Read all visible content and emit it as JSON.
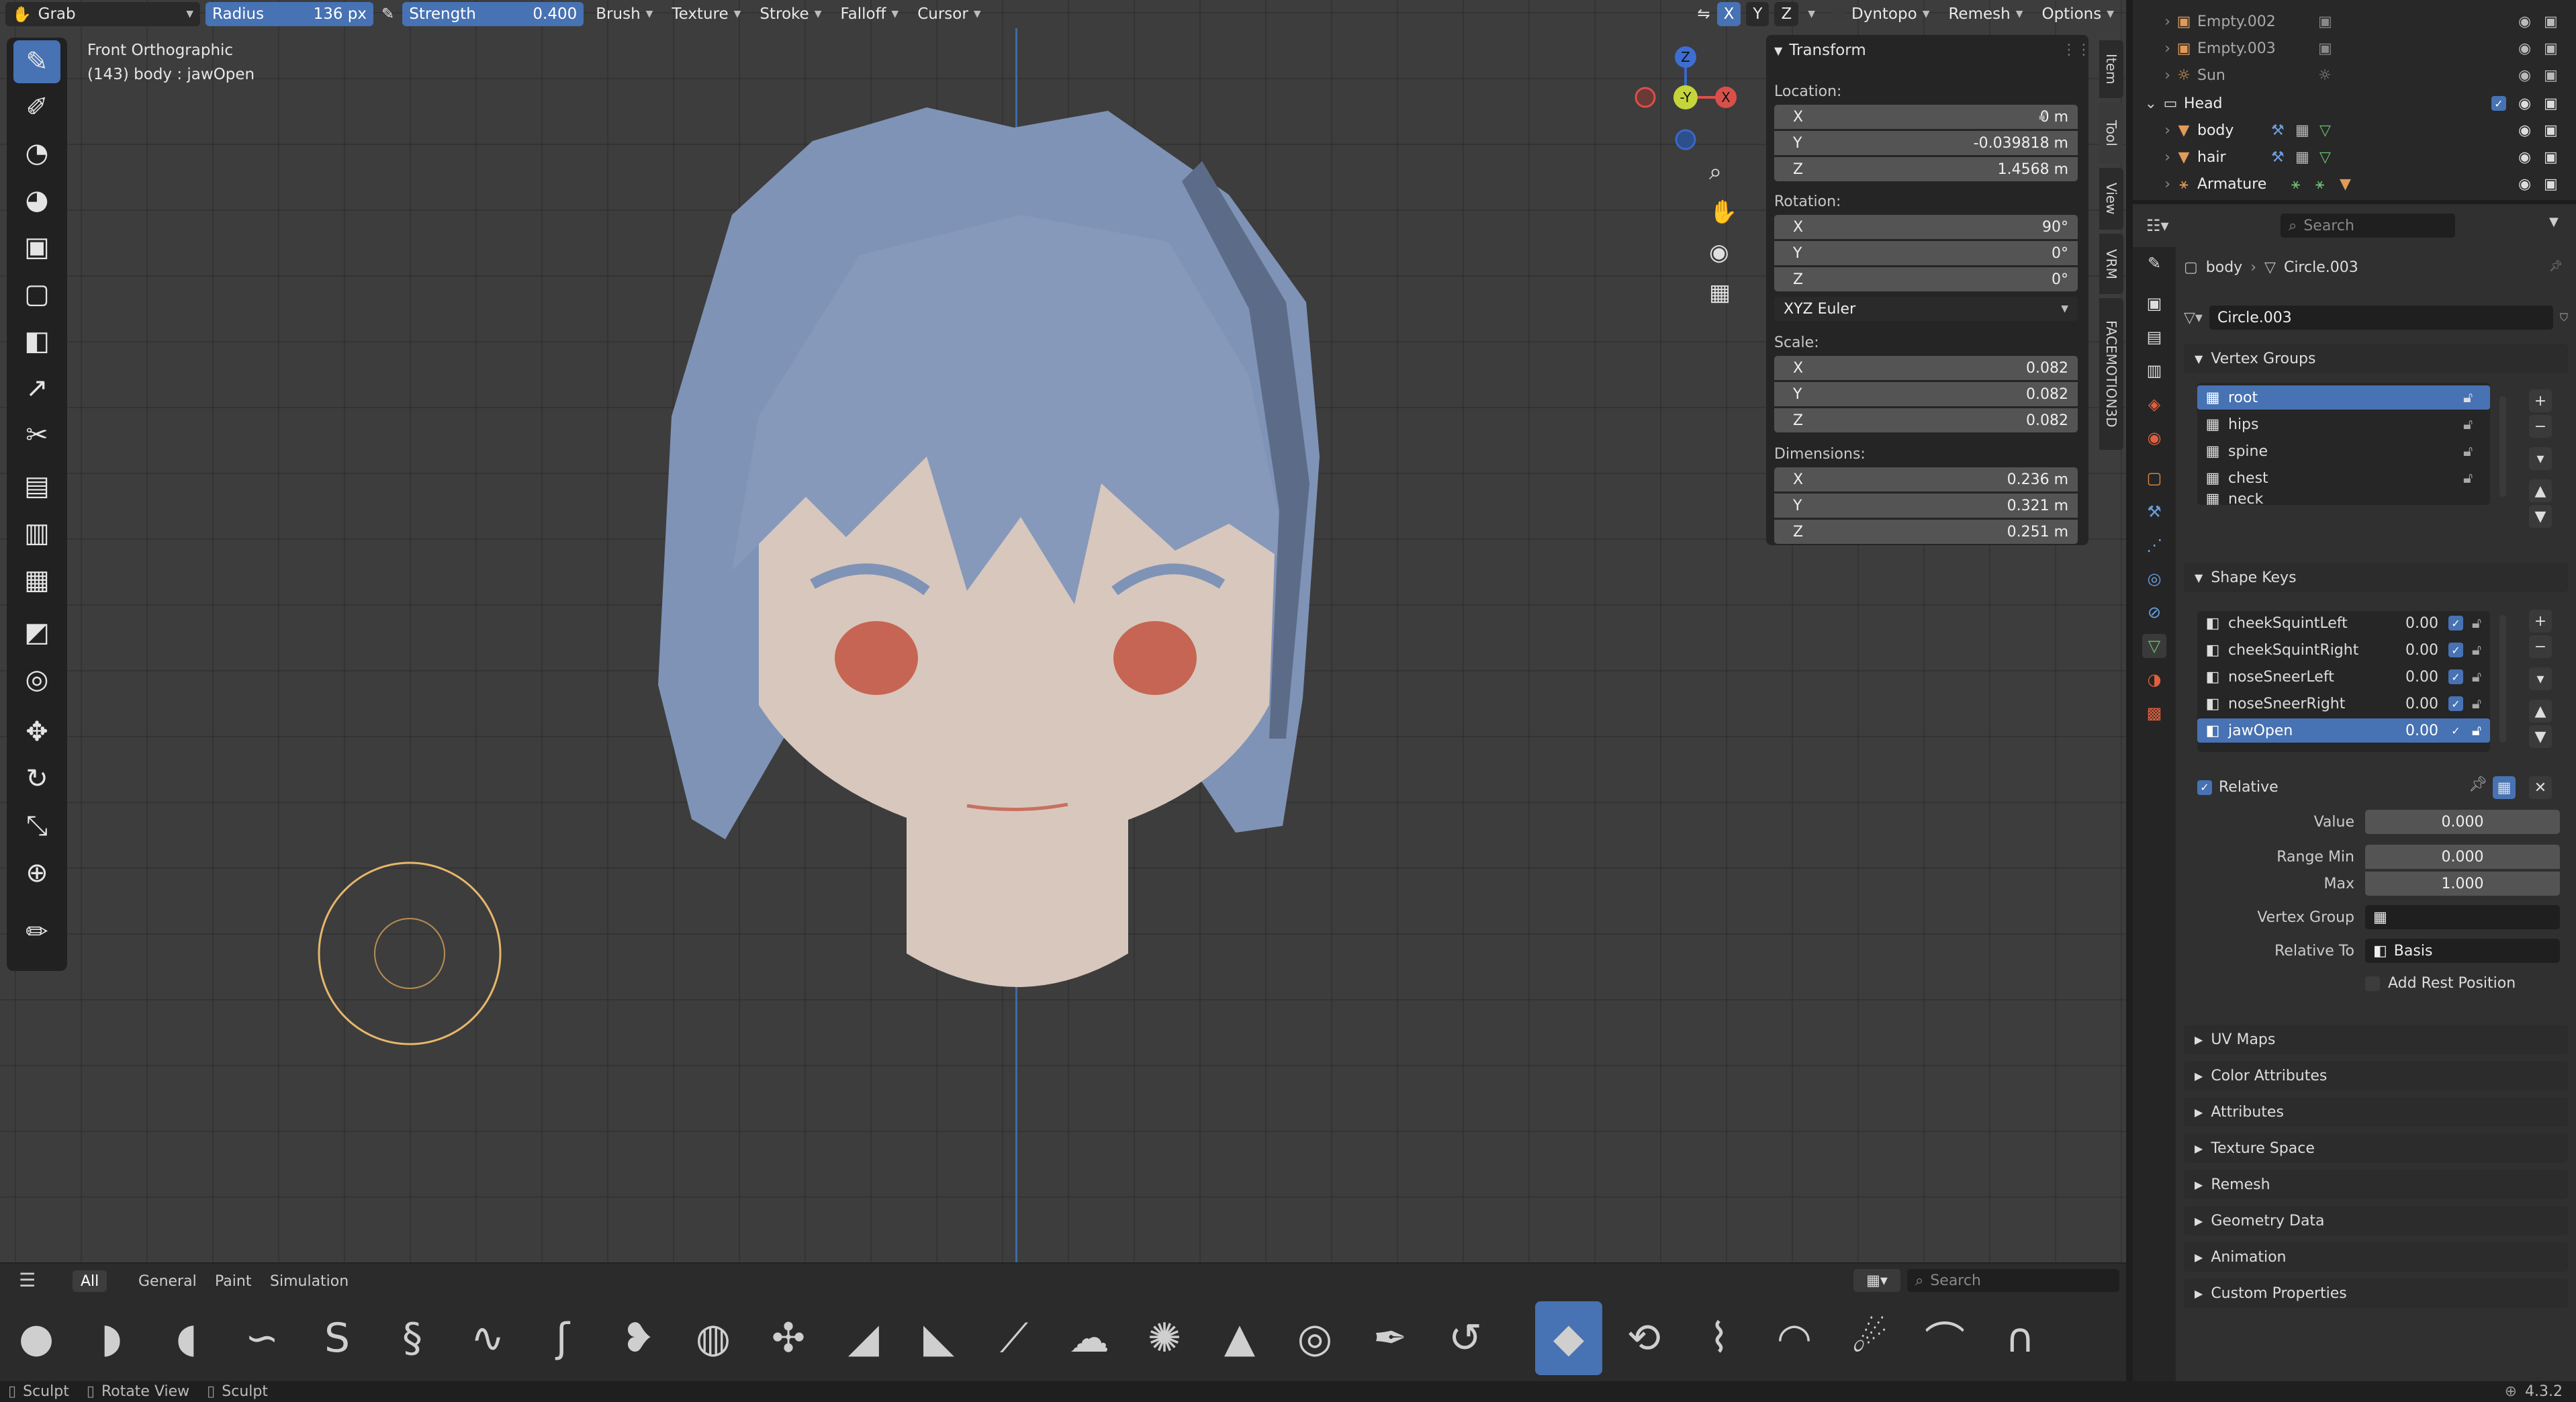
{
  "header": {
    "mode": "Grab",
    "radius_label": "Radius",
    "radius_value": "136 px",
    "strength_label": "Strength",
    "strength_value": "0.400",
    "menus": [
      "Brush",
      "Texture",
      "Stroke",
      "Falloff",
      "Cursor"
    ],
    "axes": [
      "X",
      "Y",
      "Z"
    ],
    "dyntopo": "Dyntopo",
    "remesh": "Remesh",
    "options": "Options"
  },
  "viewport": {
    "view_name": "Front Orthographic",
    "object_info": "(143) body : jawOpen",
    "gizmo": {
      "z": "Z",
      "y": "-Y",
      "x": "X"
    }
  },
  "transform": {
    "title": "Transform",
    "location_label": "Location:",
    "location": {
      "x": "0 m",
      "y": "-0.039818 m",
      "z": "1.4568 m"
    },
    "rotation_label": "Rotation:",
    "rotation": {
      "x": "90°",
      "y": "0°",
      "z": "0°"
    },
    "rotation_mode": "XYZ Euler",
    "scale_label": "Scale:",
    "scale": {
      "x": "0.082",
      "y": "0.082",
      "z": "0.082"
    },
    "dimensions_label": "Dimensions:",
    "dimensions": {
      "x": "0.236 m",
      "y": "0.321 m",
      "z": "0.251 m"
    },
    "axis_labels": {
      "x": "X",
      "y": "Y",
      "z": "Z"
    }
  },
  "side_tabs": [
    "Item",
    "Tool",
    "View",
    "VRM",
    "FACEMOTION3D"
  ],
  "asset_bar": {
    "tabs": [
      "All",
      "General",
      "Paint",
      "Simulation"
    ],
    "search_placeholder": "Search"
  },
  "outliner": {
    "rows": [
      {
        "name": "Empty.002",
        "level": 2
      },
      {
        "name": "Empty.003",
        "level": 2
      },
      {
        "name": "Sun",
        "level": 2
      },
      {
        "name": "Head",
        "level": 1
      },
      {
        "name": "body",
        "level": 2
      },
      {
        "name": "hair",
        "level": 2
      },
      {
        "name": "Armature",
        "level": 1
      }
    ]
  },
  "properties": {
    "search_placeholder": "Search",
    "breadcrumb_object": "body",
    "breadcrumb_data": "Circle.003",
    "data_name": "Circle.003",
    "vertex_groups_title": "Vertex Groups",
    "vertex_groups": [
      "root",
      "hips",
      "spine",
      "chest",
      "neck"
    ],
    "shape_keys_title": "Shape Keys",
    "shape_keys": [
      {
        "name": "cheekSquintLeft",
        "value": "0.00"
      },
      {
        "name": "cheekSquintRight",
        "value": "0.00"
      },
      {
        "name": "noseSneerLeft",
        "value": "0.00"
      },
      {
        "name": "noseSneerRight",
        "value": "0.00"
      },
      {
        "name": "jawOpen",
        "value": "0.00"
      }
    ],
    "relative_label": "Relative",
    "value_label": "Value",
    "value": "0.000",
    "range_min_label": "Range Min",
    "range_min": "0.000",
    "max_label": "Max",
    "max": "1.000",
    "vertex_group_label": "Vertex Group",
    "relative_to_label": "Relative To",
    "relative_to": "Basis",
    "add_rest_label": "Add Rest Position",
    "sections": [
      "UV Maps",
      "Color Attributes",
      "Attributes",
      "Texture Space",
      "Remesh",
      "Geometry Data",
      "Animation",
      "Custom Properties"
    ]
  },
  "status": {
    "items": [
      "Sculpt",
      "Rotate View",
      "Sculpt"
    ],
    "version": "4.3.2"
  },
  "colors": {
    "accent": "#4772b3",
    "hair": "#8496b8",
    "skin": "#d7c6bc",
    "eyes": "#c86553"
  }
}
